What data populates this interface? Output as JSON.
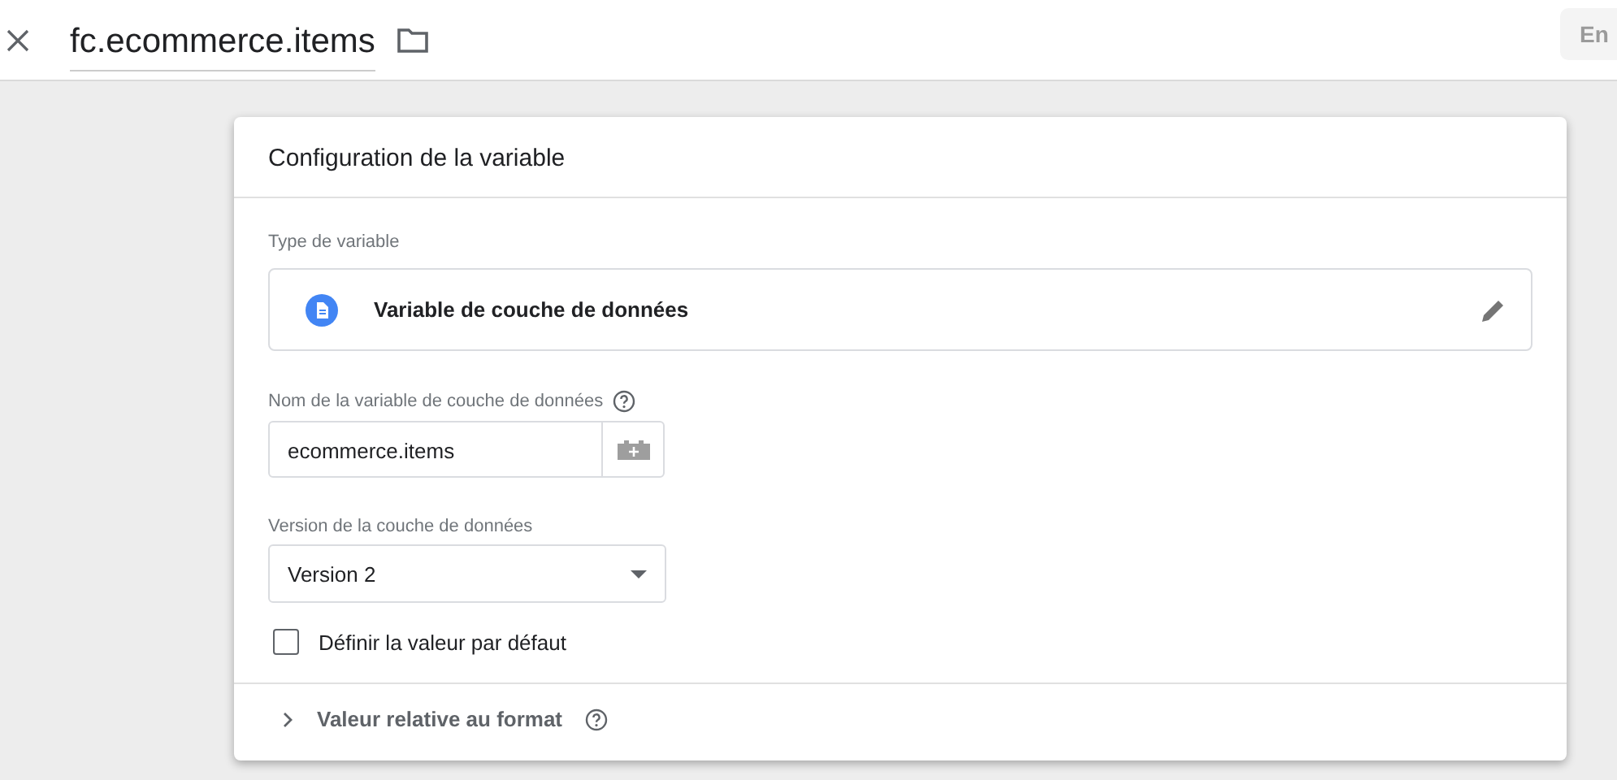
{
  "header": {
    "title": "fc.ecommerce.items",
    "save_button": "En"
  },
  "card": {
    "title": "Configuration de la variable",
    "type_label": "Type de variable",
    "type_name": "Variable de couche de données",
    "name_field": {
      "label": "Nom de la variable de couche de données",
      "value": "ecommerce.items"
    },
    "version_field": {
      "label": "Version de la couche de données",
      "value": "Version 2"
    },
    "default_value": {
      "label": "Définir la valeur par défaut",
      "checked": false
    },
    "format_section": {
      "label": "Valeur relative au format",
      "expanded": false
    }
  }
}
